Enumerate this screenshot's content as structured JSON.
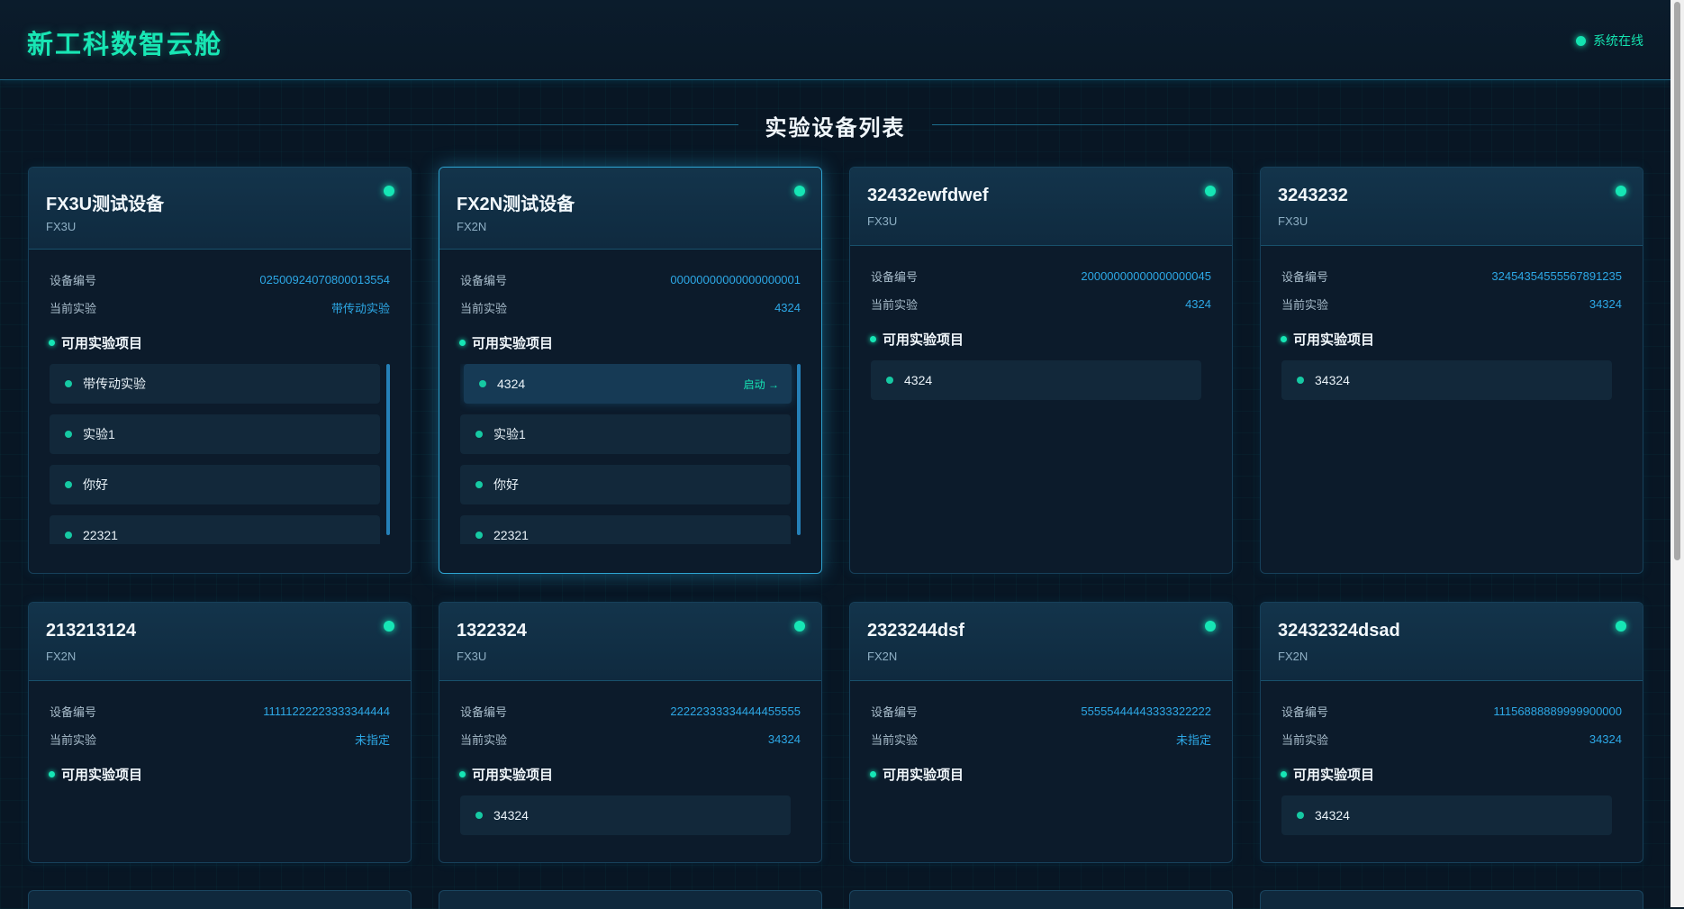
{
  "app": {
    "brand": "新工科数智云舱",
    "status_text": "系统在线",
    "status_color": "#14e3b0"
  },
  "page": {
    "title": "实验设备列表"
  },
  "labels": {
    "device_no": "设备编号",
    "current_exp": "当前实验",
    "available": "可用实验项目",
    "launch": "启动 →"
  },
  "devices": [
    {
      "name": "FX3U测试设备",
      "model": "FX3U",
      "device_no": "02500924070800013554",
      "current": "带传动实验",
      "experiments": [
        "带传动实验",
        "实验1",
        "你好",
        "22321"
      ]
    },
    {
      "name": "FX2N测试设备",
      "model": "FX2N",
      "device_no": "00000000000000000001",
      "current": "4324",
      "experiments": [
        "4324",
        "实验1",
        "你好",
        "22321"
      ],
      "highlighted_experiment": "4324"
    },
    {
      "name": "32432ewfdwef",
      "model": "FX3U",
      "device_no": "20000000000000000045",
      "current": "4324",
      "experiments": [
        "4324"
      ]
    },
    {
      "name": "3243232",
      "model": "FX3U",
      "device_no": "32454354555567891235",
      "current": "34324",
      "experiments": [
        "34324"
      ]
    },
    {
      "name": "213213124",
      "model": "FX2N",
      "device_no": "11111222223333344444",
      "current": "未指定",
      "experiments": []
    },
    {
      "name": "1322324",
      "model": "FX3U",
      "device_no": "22222333334444455555",
      "current": "34324",
      "experiments": [
        "34324"
      ]
    },
    {
      "name": "2323244dsf",
      "model": "FX2N",
      "device_no": "55555444443333322222",
      "current": "未指定",
      "experiments": []
    },
    {
      "name": "32432324dsad",
      "model": "FX2N",
      "device_no": "11156888889999900000",
      "current": "34324",
      "experiments": [
        "34324"
      ]
    }
  ]
}
